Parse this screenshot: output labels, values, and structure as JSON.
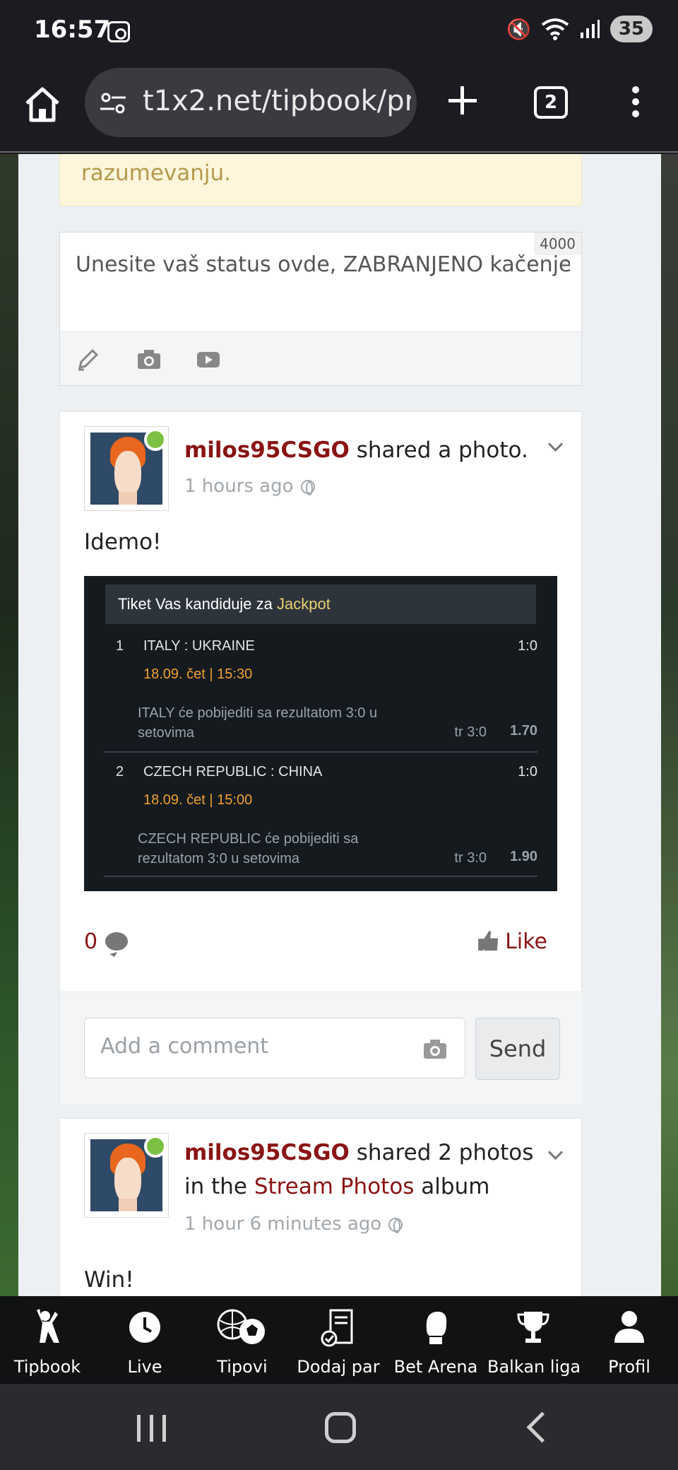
{
  "status_bar": {
    "time": "16:57",
    "battery": "35"
  },
  "browser": {
    "url": "t1x2.net/tipbook/profile",
    "tab_count": "2"
  },
  "notice": {
    "text": "razumevanju."
  },
  "composer": {
    "char_limit": "4000",
    "placeholder": "Unesite vaš status ovde, ZABRANJENO kačenje"
  },
  "post1": {
    "username": "milos95CSGO",
    "action": " shared a photo.",
    "time": "1 hours ago",
    "text": "Idemo!",
    "comment_count": "0",
    "like_label": "Like",
    "comment_placeholder": "Add a comment",
    "send_label": "Send",
    "ticket": {
      "header_prefix": "Tiket Vas kandiduje za ",
      "header_highlight": "Jackpot",
      "matches": [
        {
          "num": "1",
          "teams": "ITALY : UKRAINE",
          "score": "1:0",
          "date": "18.09. čet | 15:30",
          "desc": "ITALY će pobijediti sa rezultatom 3:0 u setovima",
          "tip": "tr 3:0",
          "odd": "1.70"
        },
        {
          "num": "2",
          "teams": "CZECH REPUBLIC : CHINA",
          "score": "1:0",
          "date": "18.09. čet | 15:00",
          "desc": "CZECH REPUBLIC će pobijediti sa rezultatom 3:0 u setovima",
          "tip": "tr 3:0",
          "odd": "1.90"
        }
      ]
    }
  },
  "post2": {
    "username": "milos95CSGO",
    "action_prefix": " shared 2 photos in the ",
    "album": "Stream Photos",
    "action_suffix": " album",
    "time": "1 hour 6 minutes ago",
    "text": "Win!"
  },
  "site_nav": [
    "Tipbook",
    "Live",
    "Tipovi",
    "Dodaj par",
    "Bet Arena",
    "Balkan liga",
    "Profil"
  ],
  "colors": {
    "accent": "#8a1414",
    "online": "#7bc043",
    "ticket_date": "#f0a030"
  }
}
